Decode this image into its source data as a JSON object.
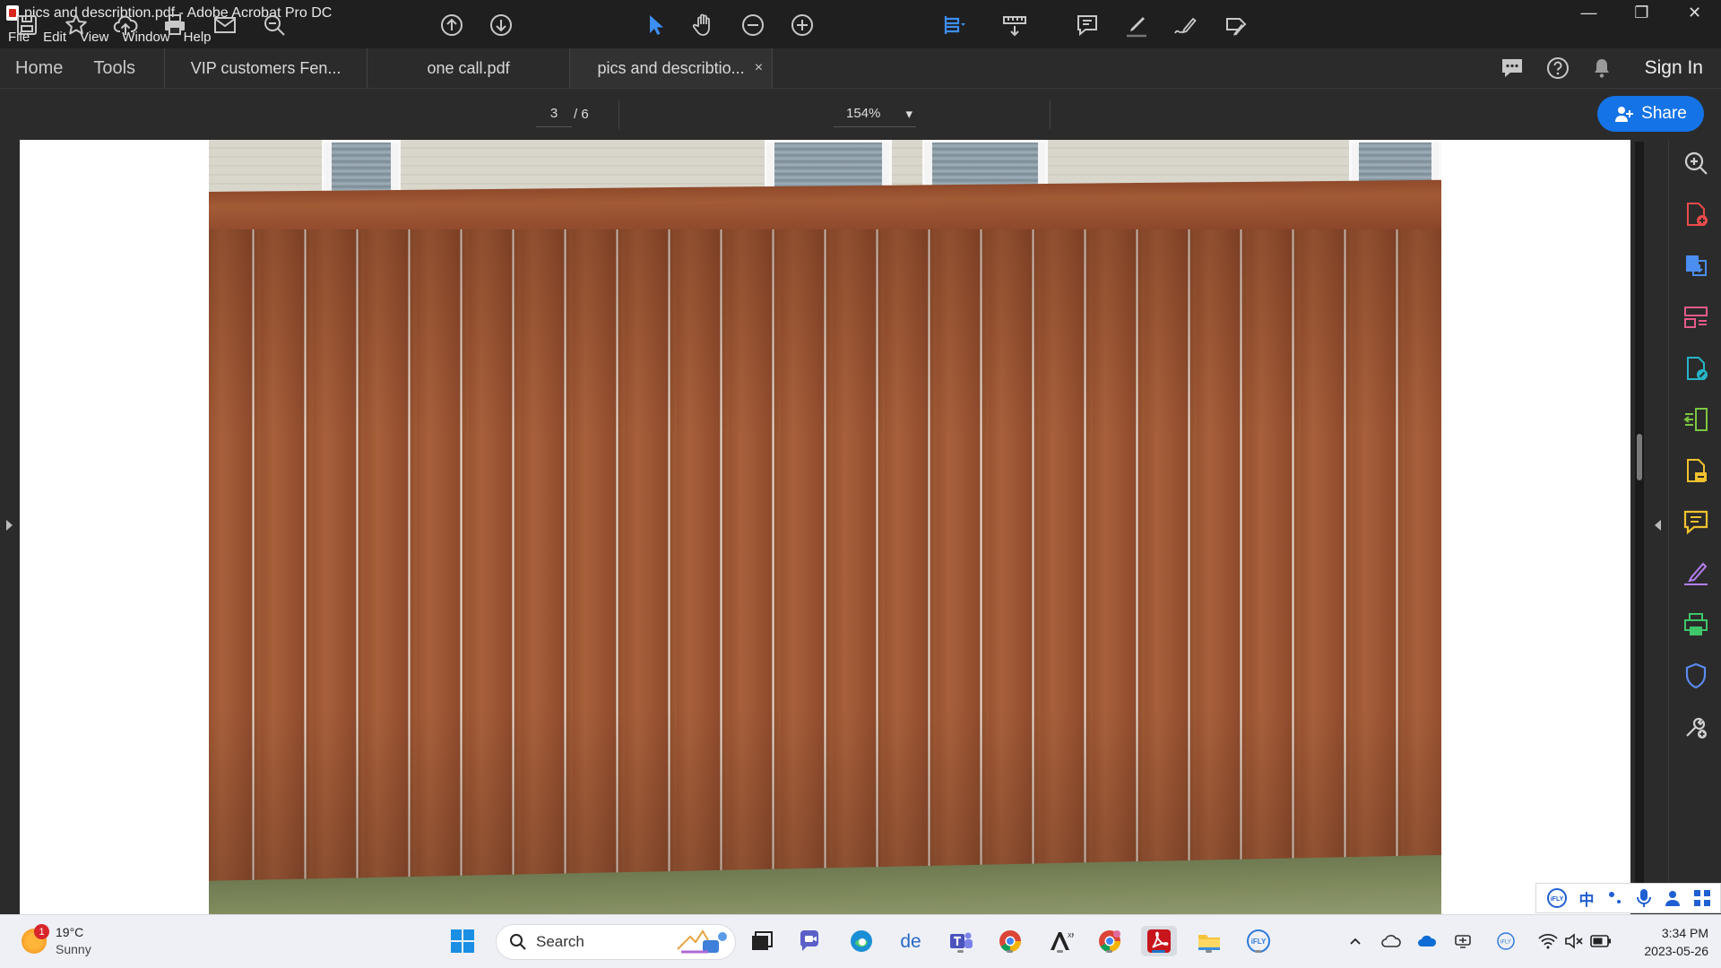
{
  "window": {
    "title": "pics and describtion.pdf - Adobe Acrobat Pro DC",
    "minimize": "—",
    "restore": "❐",
    "close": "✕"
  },
  "menu": [
    "File",
    "Edit",
    "View",
    "Window",
    "Help"
  ],
  "nav": {
    "home": "Home",
    "tools": "Tools"
  },
  "tabs": [
    {
      "label": "VIP customers  Fen...",
      "active": false
    },
    {
      "label": "one call.pdf",
      "active": false
    },
    {
      "label": "pics and describtio...",
      "active": true,
      "close": "×"
    }
  ],
  "header_right": {
    "sign_in": "Sign In"
  },
  "toolbar": {
    "current_page": "3",
    "total_pages": "/ 6",
    "zoom": "154%",
    "zoom_caret": "▾",
    "share_label": "Share"
  },
  "ime": {
    "chinese_char": "中"
  },
  "taskbar": {
    "weather_badge": "1",
    "temperature": "19°C",
    "condition": "Sunny",
    "search_label": "Search",
    "time": "3:34 PM",
    "date": "2023-05-26"
  },
  "colors": {
    "accent": "#1473e6",
    "acrobat_red": "#d9261c"
  }
}
